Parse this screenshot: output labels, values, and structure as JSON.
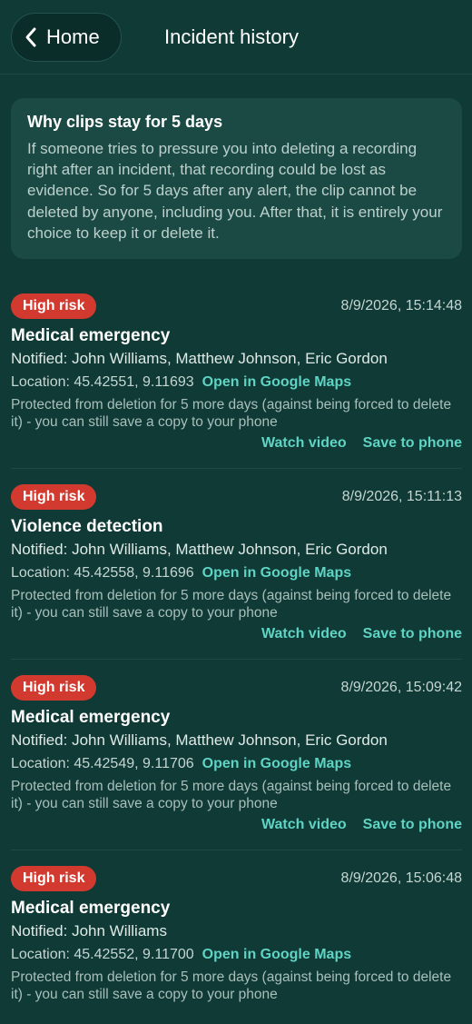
{
  "header": {
    "back_label": "Home",
    "title": "Incident history"
  },
  "info": {
    "title": "Why clips stay for 5 days",
    "body": "If someone tries to pressure you into deleting a recording right after an incident, that recording could be lost as evidence. So for 5 days after any alert, the clip cannot be deleted by anyone, including you. After that, it is entirely your choice to keep it or delete it."
  },
  "incidents": [
    {
      "risk": "High risk",
      "timestamp": "8/9/2026, 15:14:48",
      "title": "Medical emergency",
      "notified": "Notified: John Williams, Matthew Johnson, Eric Gordon",
      "location": "Location: 45.42551, 9.11693",
      "maps_label": "Open in Google Maps",
      "protected": "Protected from deletion for 5 more days (against being forced to delete it) - you can still save a copy to your phone",
      "watch_label": "Watch video",
      "save_label": "Save to phone"
    },
    {
      "risk": "High risk",
      "timestamp": "8/9/2026, 15:11:13",
      "title": "Violence detection",
      "notified": "Notified: John Williams, Matthew Johnson, Eric Gordon",
      "location": "Location: 45.42558, 9.11696",
      "maps_label": "Open in Google Maps",
      "protected": "Protected from deletion for 5 more days (against being forced to delete it) - you can still save a copy to your phone",
      "watch_label": "Watch video",
      "save_label": "Save to phone"
    },
    {
      "risk": "High risk",
      "timestamp": "8/9/2026, 15:09:42",
      "title": "Medical emergency",
      "notified": "Notified: John Williams, Matthew Johnson, Eric Gordon",
      "location": "Location: 45.42549, 9.11706",
      "maps_label": "Open in Google Maps",
      "protected": "Protected from deletion for 5 more days (against being forced to delete it) - you can still save a copy to your phone",
      "watch_label": "Watch video",
      "save_label": "Save to phone"
    },
    {
      "risk": "High risk",
      "timestamp": "8/9/2026, 15:06:48",
      "title": "Medical emergency",
      "notified": "Notified: John Williams",
      "location": "Location: 45.42552, 9.11700",
      "maps_label": "Open in Google Maps",
      "protected": "Protected from deletion for 5 more days (against being forced to delete it) - you can still save a copy to your phone"
    }
  ],
  "colors": {
    "background": "#0f3a36",
    "card": "#1b4a45",
    "accent": "#5fd4c4",
    "risk_badge": "#d23a2f"
  },
  "icons": {
    "back": "chevron-left-icon"
  }
}
